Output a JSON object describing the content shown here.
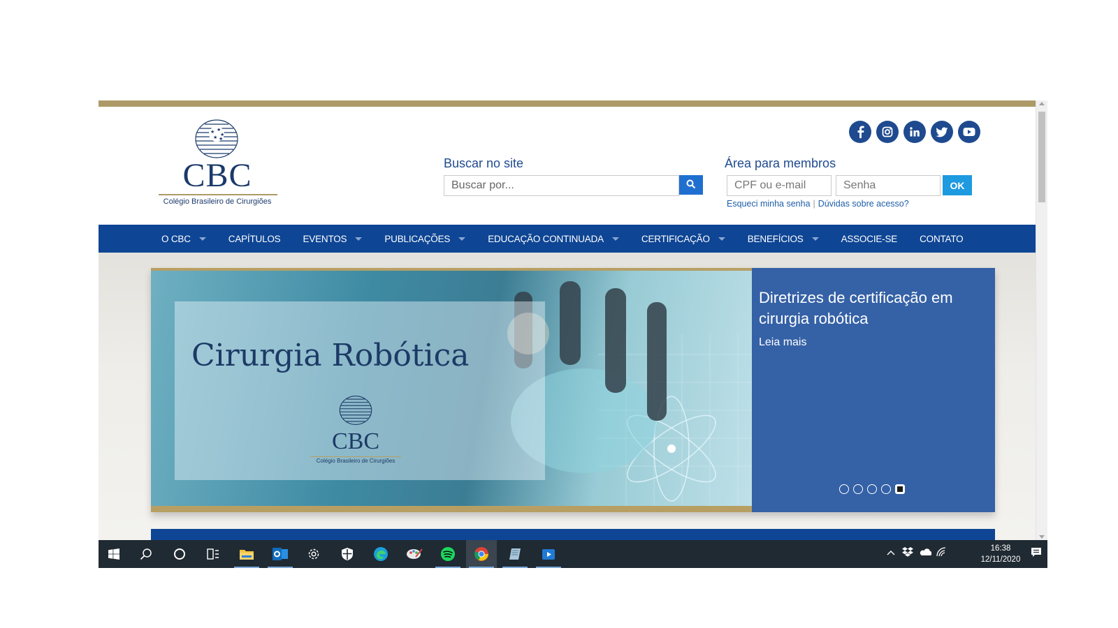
{
  "header": {
    "logo_text": "CBC",
    "logo_subtitle": "Colégio Brasileiro de Cirurgiões",
    "search": {
      "heading": "Buscar no site",
      "placeholder": "Buscar por..."
    },
    "members": {
      "heading": "Área para membros",
      "cpf_placeholder": "CPF ou e-mail",
      "password_placeholder": "Senha",
      "ok_label": "OK",
      "forgot_password": "Esqueci minha senha",
      "separator": "|",
      "access_help": "Dúvidas sobre acesso?"
    },
    "social": [
      "facebook-icon",
      "instagram-icon",
      "linkedin-icon",
      "twitter-icon",
      "youtube-icon"
    ]
  },
  "nav": {
    "items": [
      {
        "label": "O CBC",
        "has_dropdown": true
      },
      {
        "label": "CAPÍTULOS",
        "has_dropdown": false
      },
      {
        "label": "EVENTOS",
        "has_dropdown": true
      },
      {
        "label": "PUBLICAÇÕES",
        "has_dropdown": true
      },
      {
        "label": "EDUCAÇÃO CONTINUADA",
        "has_dropdown": true
      },
      {
        "label": "CERTIFICAÇÃO",
        "has_dropdown": true
      },
      {
        "label": "BENEFÍCIOS",
        "has_dropdown": true
      },
      {
        "label": "ASSOCIE-SE",
        "has_dropdown": false
      },
      {
        "label": "CONTATO",
        "has_dropdown": false
      }
    ]
  },
  "slider": {
    "image_heading": "Cirurgia Robótica",
    "image_logo_text": "CBC",
    "image_logo_subtitle": "Colégio Brasileiro de Cirurgiões",
    "title": "Diretrizes de certificação em cirurgia robótica",
    "link": "Leia mais",
    "slide_count": 5,
    "active_slide": 5
  },
  "taskbar": {
    "apps": [
      "windows-start-icon",
      "search-icon",
      "cortana-icon",
      "task-view-icon",
      "file-explorer-icon",
      "outlook-icon",
      "settings-icon",
      "security-icon",
      "edge-icon",
      "paint-icon",
      "spotify-icon",
      "chrome-icon",
      "notepad-icon",
      "media-player-icon"
    ],
    "time": "16:38",
    "date": "12/11/2020"
  },
  "colors": {
    "brand_blue": "#0e4594",
    "gold": "#ad9a67",
    "slide_panel": "#3561a6",
    "button_blue": "#1e9ae0"
  }
}
